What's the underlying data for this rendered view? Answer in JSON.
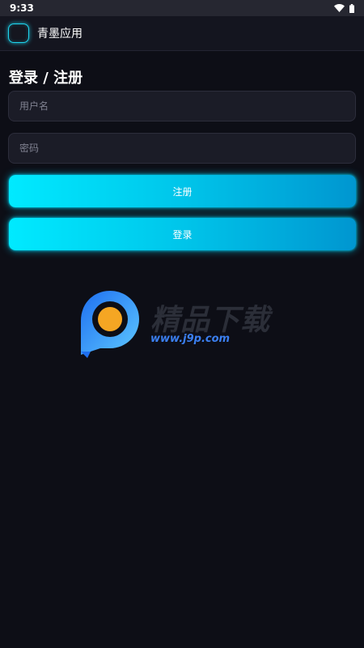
{
  "status_bar": {
    "time": "9:33",
    "icons": [
      "wifi-icon",
      "battery-icon"
    ]
  },
  "app_bar": {
    "title": "青墨应用",
    "logo_icon": "app-logo-icon"
  },
  "form": {
    "heading": "登录 / 注册",
    "username": {
      "placeholder": "用户名",
      "value": ""
    },
    "password": {
      "placeholder": "密码",
      "value": ""
    },
    "register_label": "注册",
    "login_label": "登录"
  },
  "watermark": {
    "name": "精品下载",
    "url": "www.j9p.com"
  },
  "colors": {
    "background": "#0d0e16",
    "accent_start": "#00eaff",
    "accent_end": "#0096d0",
    "field_background": "#1b1c27",
    "logo_glow": "#1fd5ee",
    "watermark_blue": "#3b7ff0",
    "watermark_orange": "#f5a623"
  }
}
